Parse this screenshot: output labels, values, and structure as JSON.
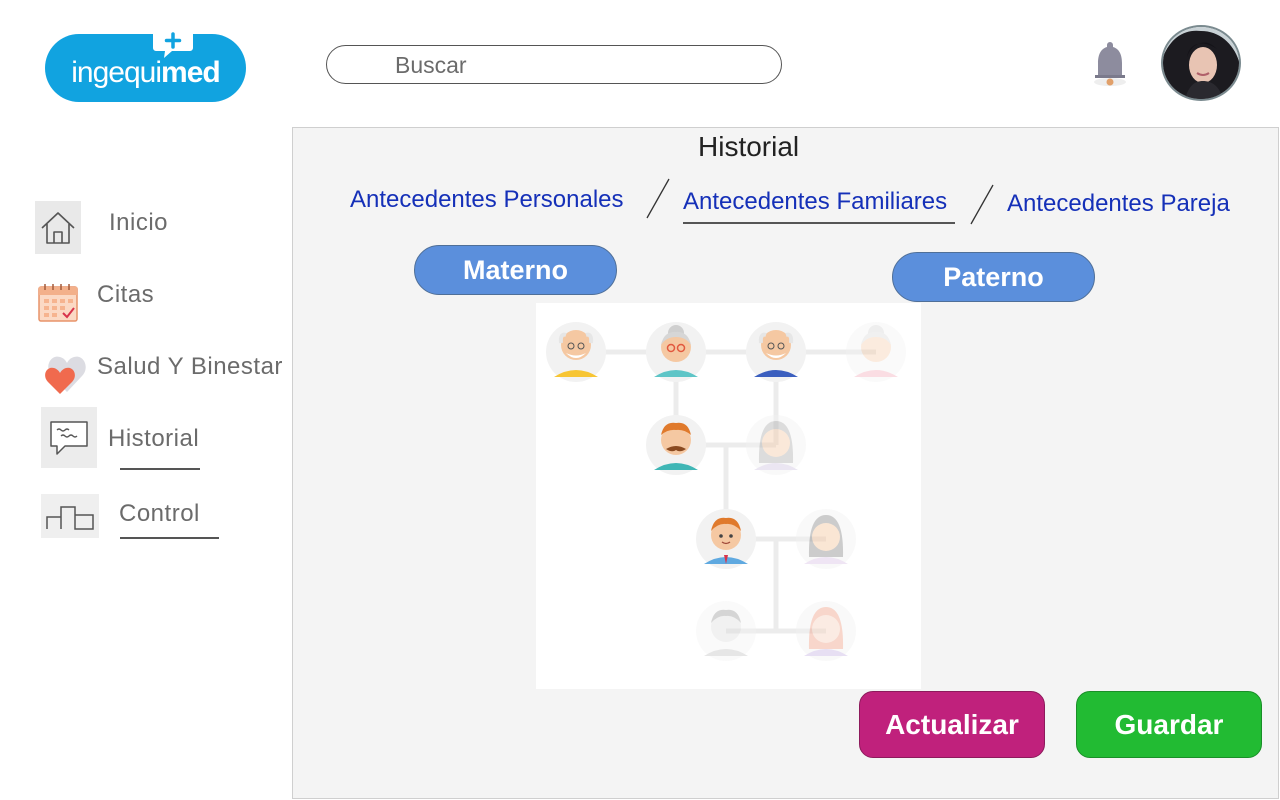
{
  "header": {
    "logo": {
      "text_regular": "ingequi",
      "text_bold": "med"
    },
    "search": {
      "placeholder": "Buscar",
      "value": ""
    }
  },
  "sidebar": {
    "items": [
      {
        "label": "Inicio",
        "icon": "home-icon"
      },
      {
        "label": "Citas",
        "icon": "calendar-icon"
      },
      {
        "label": "Salud Y Binestar",
        "icon": "heart-icon"
      },
      {
        "label": "Historial",
        "icon": "chat-icon"
      },
      {
        "label": "Control",
        "icon": "podium-icon"
      }
    ]
  },
  "main": {
    "title": "Historial",
    "tabs": [
      {
        "label": "Antecedentes Personales",
        "active": false
      },
      {
        "label": "Antecedentes Familiares",
        "active": true
      },
      {
        "label": "Antecedentes Pareja",
        "active": false
      }
    ],
    "lineage_buttons": {
      "maternal": "Materno",
      "paternal": "Paterno"
    },
    "actions": {
      "update": "Actualizar",
      "save": "Guardar"
    }
  },
  "colors": {
    "brand": "#11a3e0",
    "tab_link": "#1530b8",
    "pill": "#5b8fdc",
    "update_button": "#c0217c",
    "save_button": "#22bb33"
  }
}
